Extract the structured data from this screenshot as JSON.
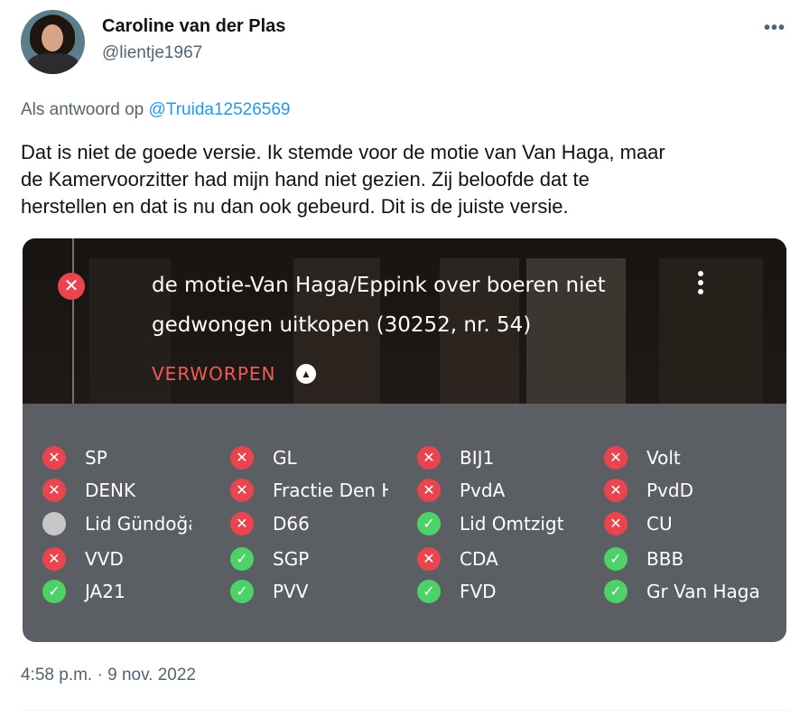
{
  "author": {
    "name": "Caroline van der Plas",
    "handle": "@lientje1967",
    "more_icon": "ellipsis-icon"
  },
  "reply": {
    "prefix": "Als antwoord op",
    "target": "@Truida12526569"
  },
  "tweet": {
    "lines": [
      "Dat is niet de goede versie. Ik stemde voor de motie van Van Haga, maar",
      "de Kamervoorzitter had mijn hand niet gezien. Zij beloofde dat te",
      "herstellen en dat is nu dan ook gebeurd. Dit is de juiste versie."
    ],
    "timestamp": "4:58 p.m. · 9 nov. 2022"
  },
  "card": {
    "motion_lines": [
      "de motie-Van Haga/Eppink over boeren niet",
      "gedwongen uitkopen (30252, nr. 54)"
    ],
    "status": "VERWORPEN",
    "colors": {
      "against": "#e8454e",
      "for": "#4cd266",
      "absent": "#c7c7c7",
      "status": "#f05a5a"
    },
    "votes": [
      [
        {
          "party": "SP",
          "vote": "against"
        },
        {
          "party": "DENK",
          "vote": "against"
        },
        {
          "party": "Lid Gündoğan",
          "vote": "absent"
        },
        {
          "party": "VVD",
          "vote": "against"
        },
        {
          "party": "JA21",
          "vote": "for"
        }
      ],
      [
        {
          "party": "GL",
          "vote": "against"
        },
        {
          "party": "Fractie Den Haan",
          "vote": "against"
        },
        {
          "party": "D66",
          "vote": "against"
        },
        {
          "party": "SGP",
          "vote": "for"
        },
        {
          "party": "PVV",
          "vote": "for"
        }
      ],
      [
        {
          "party": "BIJ1",
          "vote": "against"
        },
        {
          "party": "PvdA",
          "vote": "against"
        },
        {
          "party": "Lid Omtzigt",
          "vote": "for"
        },
        {
          "party": "CDA",
          "vote": "against"
        },
        {
          "party": "FVD",
          "vote": "for"
        }
      ],
      [
        {
          "party": "Volt",
          "vote": "against"
        },
        {
          "party": "PvdD",
          "vote": "against"
        },
        {
          "party": "CU",
          "vote": "against"
        },
        {
          "party": "BBB",
          "vote": "for"
        },
        {
          "party": "Gr Van Haga",
          "vote": "for"
        }
      ]
    ]
  }
}
